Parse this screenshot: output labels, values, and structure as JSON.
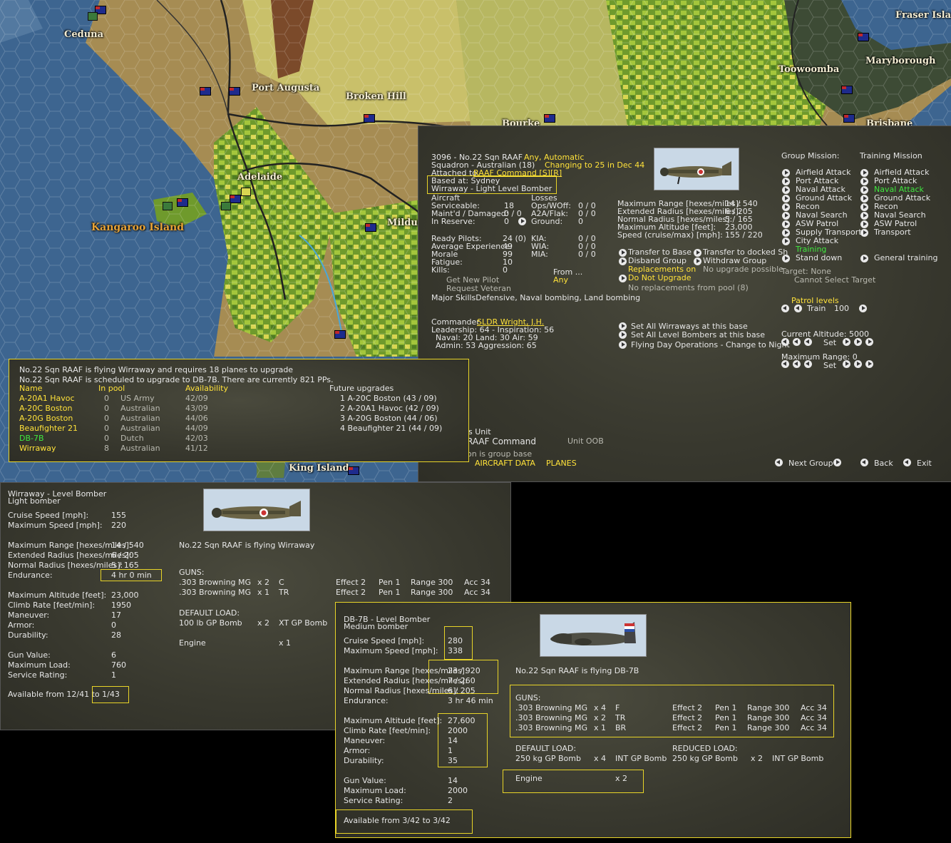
{
  "map": {
    "labels": {
      "ceduna": "Ceduna",
      "port_augusta": "Port Augusta",
      "broken_hill": "Broken Hill",
      "adelaide": "Adelaide",
      "kangaroo_island": "Kangaroo Island",
      "mildura": "Mildur",
      "bourke": "Bourke",
      "toowoomba": "Toowoomba",
      "maryborough": "Maryborough",
      "fraser_island": "Fraser Island",
      "brisbane": "Brisbane",
      "king_island": "King Island"
    }
  },
  "group": {
    "title": "3096 - No.22 Sqn RAAF",
    "mode": "Any, Automatic",
    "squadron": "Squadron - Australian (18)",
    "changing": "Changing to 25 in Dec 44",
    "attached_label": "Attached to",
    "attached_value": "RAAF Command [S][R]",
    "based_at": "Based at:  Sydney",
    "aircraft_line": "Wirraway - Light Level Bomber",
    "aircraft_header": "Aircraft",
    "losses_header": "Losses",
    "stats_left": [
      {
        "label": "Serviceable:",
        "value": "18"
      },
      {
        "label": "Maint'd / Damaged:",
        "value": "0 / 0"
      },
      {
        "label": "In Reserve:",
        "value": "0"
      }
    ],
    "stats_losses": [
      {
        "label": "Ops/WOff:",
        "value": "0 / 0"
      },
      {
        "label": "A2A/Flak:",
        "value": "0 / 0"
      },
      {
        "label": "Ground:",
        "value": "0"
      }
    ],
    "pilots": [
      {
        "label": "Ready Pilots:",
        "value": "24 (0)"
      },
      {
        "label": "Average Experience:",
        "value": "49"
      },
      {
        "label": "Morale",
        "value": "99"
      },
      {
        "label": "Fatigue:",
        "value": "10"
      },
      {
        "label": "Kills:",
        "value": "0"
      }
    ],
    "pilot_losses": [
      {
        "label": "KIA:",
        "value": "0 / 0"
      },
      {
        "label": "WIA:",
        "value": "0 / 0"
      },
      {
        "label": "MIA:",
        "value": "0 / 0"
      }
    ],
    "get_new_pilot": "Get New Pilot",
    "request_veteran": "Request Veteran",
    "from_label": "From ...",
    "from_value": "Any",
    "major_skills": "Major SkillsDefensive, Naval bombing, Land bombing",
    "range_stats": [
      {
        "label": "Maximum Range [hexes/miles]:",
        "value": "14 / 540"
      },
      {
        "label": "Extended Radius [hexes/miles]:",
        "value": "6 / 205"
      },
      {
        "label": "Normal Radius [hexes/miles]:",
        "value": "5 / 165"
      },
      {
        "label": "Maximum Altitude [feet]:",
        "value": "23,000"
      },
      {
        "label": "Speed (cruise/max) [mph]:",
        "value": "155 / 220"
      }
    ],
    "actions": {
      "transfer_base": "Transfer to Base",
      "transfer_docked": "Transfer to docked Sh",
      "disband": "Disband Group",
      "withdraw": "Withdraw Group",
      "replacements": "Replacements on",
      "no_upgrade_possible": "No upgrade possible",
      "do_not_upgrade": "Do Not Upgrade",
      "no_replacements": "No replacements from pool (8)"
    },
    "commander_label": "Commander",
    "commander_name": "SLDR Wright, J.H.",
    "leadership": "Leadership: 64 - Inspiration: 56",
    "naval_land_air": "Naval: 20   Land: 30   Air: 59",
    "admin_aggr": "Admin: 53   Aggression: 65",
    "set_all_wirraways": "Set All Wirraways at this base",
    "set_all_level": "Set All Level Bombers at this base",
    "flying_day": "Flying Day Operations - Change to Night",
    "group_mission_header": "Group Mission:",
    "training_mission_header": "Training Mission",
    "group_missions": [
      "Airfield Attack",
      "Port Attack",
      "Naval Attack",
      "Ground Attack",
      "Recon",
      "Naval Search",
      "ASW Patrol",
      "Supply Transport",
      "City Attack"
    ],
    "training_missions": [
      "Airfield Attack",
      "Port Attack",
      "Naval Attack",
      "Ground Attack",
      "Recon",
      "Naval Search",
      "ASW Patrol",
      "Transport"
    ],
    "training_label": "Training",
    "stand_down": "Stand down",
    "general_training": "General training",
    "target": "Target: None",
    "cannot_select": "Cannot Select Target",
    "patrol_levels": "Patrol levels",
    "train_label": "Train",
    "train_value": "100",
    "current_altitude": "Current Altitude: 5000",
    "set_label": "Set",
    "maximum_range": "Maximum Range: 0",
    "unit_partial": "s Unit",
    "raaf_command": "RAAF Command",
    "unit_oob": "Unit OOB",
    "group_base_partial": "on is group base",
    "aircraft_data": "AIRCRAFT DATA",
    "planes": "PLANES",
    "next_group": "Next Group",
    "back": "Back",
    "exit": "Exit"
  },
  "upgrade": {
    "line1": "No.22 Sqn RAAF is flying Wirraway and requires 18 planes to upgrade",
    "line2": "No.22 Sqn RAAF is scheduled to upgrade to DB-7B. There are currently 821 PPs.",
    "headers": {
      "name": "Name",
      "pool": "In pool",
      "availability": "Availability",
      "future": "Future upgrades"
    },
    "rows": [
      {
        "name": "A-20A1 Havoc",
        "pool": "0",
        "nation": "US Army",
        "avail": "42/09"
      },
      {
        "name": "A-20C Boston",
        "pool": "0",
        "nation": "Australian",
        "avail": "43/09"
      },
      {
        "name": "A-20G Boston",
        "pool": "0",
        "nation": "Australian",
        "avail": "44/06"
      },
      {
        "name": "Beaufighter 21",
        "pool": "0",
        "nation": "Australian",
        "avail": "44/09"
      },
      {
        "name": "DB-7B",
        "pool": "0",
        "nation": "Dutch",
        "avail": "42/03"
      },
      {
        "name": "Wirraway",
        "pool": "8",
        "nation": "Australian",
        "avail": "41/12"
      }
    ],
    "future": [
      "1  A-20C Boston  (43 / 09)",
      "2  A-20A1 Havoc  (42 / 09)",
      "3  A-20G Boston  (44 / 06)",
      "4  Beaufighter 21  (44 / 09)"
    ]
  },
  "wirraway": {
    "title": "Wirraway - Level Bomber",
    "subtitle": "Light bomber",
    "stats": [
      {
        "label": "Cruise Speed [mph]:",
        "value": "155"
      },
      {
        "label": "Maximum Speed [mph]:",
        "value": "220"
      },
      {
        "label": "Maximum Range [hexes/miles]:",
        "value": "14 / 540"
      },
      {
        "label": "Extended Radius [hexes/miles]:",
        "value": "6 / 205"
      },
      {
        "label": "Normal Radius [hexes/miles]:",
        "value": "5 / 165"
      },
      {
        "label": "Endurance:",
        "value": "4 hr  0 min"
      },
      {
        "label": "Maximum Altitude [feet]:",
        "value": "23,000"
      },
      {
        "label": "Climb Rate [feet/min]:",
        "value": "1950"
      },
      {
        "label": "Maneuver:",
        "value": "17"
      },
      {
        "label": "Armor:",
        "value": "0"
      },
      {
        "label": "Durability:",
        "value": "28"
      },
      {
        "label": "Gun Value:",
        "value": "6"
      },
      {
        "label": "Maximum Load:",
        "value": "760"
      },
      {
        "label": "Service Rating:",
        "value": "1"
      }
    ],
    "available_from": "Available from  12/41 to 1/43",
    "flying": "No.22 Sqn RAAF is flying Wirraway",
    "guns_header": "GUNS:",
    "guns": [
      {
        "name": ".303 Browning MG",
        "count": "x 2",
        "facing": "C",
        "effect": "Effect 2",
        "pen": "Pen 1",
        "range": "Range 300",
        "acc": "Acc 34"
      },
      {
        "name": ".303 Browning MG",
        "count": "x 1",
        "facing": "TR",
        "effect": "Effect 2",
        "pen": "Pen 1",
        "range": "Range 300",
        "acc": "Acc 34"
      }
    ],
    "default_load_header": "DEFAULT LOAD:",
    "load": {
      "name": "100 lb GP Bomb",
      "count": "x 2",
      "type": "XT  GP Bomb"
    },
    "engine": "Engine",
    "engine_count": "x 1"
  },
  "db7b": {
    "title": "DB-7B - Level Bomber",
    "subtitle": "Medium bomber",
    "stats": [
      {
        "label": "Cruise Speed [mph]:",
        "value": "280"
      },
      {
        "label": "Maximum Speed [mph]:",
        "value": "338"
      },
      {
        "label": "Maximum Range [hexes/miles]:",
        "value": "23 / 920"
      },
      {
        "label": "Extended Radius [hexes/miles]:",
        "value": "7 / 260"
      },
      {
        "label": "Normal Radius [hexes/miles]:",
        "value": "6 / 205"
      },
      {
        "label": "Endurance:",
        "value": "3 hr 46 min"
      },
      {
        "label": "Maximum Altitude [feet]:",
        "value": "27,600"
      },
      {
        "label": "Climb Rate [feet/min]:",
        "value": "2000"
      },
      {
        "label": "Maneuver:",
        "value": "14"
      },
      {
        "label": "Armor:",
        "value": "1"
      },
      {
        "label": "Durability:",
        "value": "35"
      },
      {
        "label": "Gun Value:",
        "value": "14"
      },
      {
        "label": "Maximum Load:",
        "value": "2000"
      },
      {
        "label": "Service Rating:",
        "value": "2"
      }
    ],
    "available_from": "Available from  3/42 to 3/42",
    "flying": "No.22 Sqn RAAF is flying DB-7B",
    "guns_header": "GUNS:",
    "guns": [
      {
        "name": ".303 Browning MG",
        "count": "x 4",
        "facing": "F",
        "effect": "Effect 2",
        "pen": "Pen 1",
        "range": "Range 300",
        "acc": "Acc 34"
      },
      {
        "name": ".303 Browning MG",
        "count": "x 2",
        "facing": "TR",
        "effect": "Effect 2",
        "pen": "Pen 1",
        "range": "Range 300",
        "acc": "Acc 34"
      },
      {
        "name": ".303 Browning MG",
        "count": "x 1",
        "facing": "BR",
        "effect": "Effect 2",
        "pen": "Pen 1",
        "range": "Range 300",
        "acc": "Acc 34"
      }
    ],
    "default_load_header": "DEFAULT LOAD:",
    "reduced_load_header": "REDUCED LOAD:",
    "load": {
      "name": "250 kg GP Bomb",
      "count": "x 4",
      "type": "INT GP Bomb"
    },
    "reduced_load": {
      "name": "250 kg GP Bomb",
      "count": "x 2",
      "type": "INT GP Bomb"
    },
    "engine": "Engine",
    "engine_count": "x 2"
  },
  "colors": {
    "yellow": "#ffe23a",
    "green": "#3fe83f",
    "highlight_box": "#e8d428",
    "panel": "#3b3b30",
    "sea": "#3d6590"
  }
}
